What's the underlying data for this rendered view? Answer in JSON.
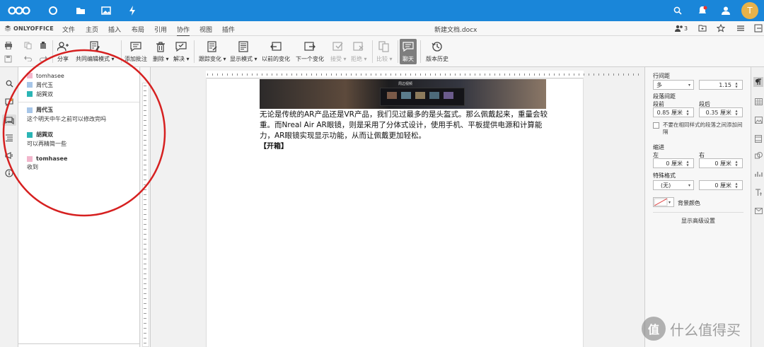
{
  "nc_bar": {
    "accent": "#1a86d9",
    "icons": [
      "nextcloud-logo",
      "dashboard-icon",
      "files-icon",
      "photos-icon",
      "activity-icon",
      "search-icon",
      "notifications-icon",
      "contacts-icon"
    ],
    "avatar_letter": "T",
    "avatar_color": "#e7b24a"
  },
  "menu": {
    "brand": "ONLYOFFICE",
    "tabs": [
      "文件",
      "主页",
      "插入",
      "布局",
      "引用",
      "协作",
      "视图",
      "插件"
    ],
    "active_tab": "协作",
    "doc_title": "新建文档.docx",
    "users_count": "3"
  },
  "toolbar": {
    "share": "分享",
    "coedit_mode": "共同编辑模式",
    "add_comment": "添加批注",
    "delete": "删除",
    "resolve": "解决",
    "track_changes": "跟踪变化",
    "display_mode": "显示模式",
    "prev_change": "以前的变化",
    "next_change": "下一个变化",
    "accept": "接受",
    "reject": "拒绝",
    "compare": "比较",
    "chat": "聊天",
    "version_history": "版本历史"
  },
  "chat": {
    "users": [
      {
        "name": "tomhasee",
        "color": "#f2b6cc"
      },
      {
        "name": "周代玉",
        "color": "#a7c6e8"
      },
      {
        "name": "胡巽双",
        "color": "#2bb5b5"
      }
    ],
    "messages": [
      {
        "author": "周代玉",
        "color": "#a7c6e8",
        "text": "这个明天中午之前可以修改完吗"
      },
      {
        "author": "胡巽双",
        "color": "#2bb5b5",
        "text": "可以再精简一些"
      },
      {
        "author": "tomhasee",
        "color": "#f2b6cc",
        "text": "收到"
      }
    ]
  },
  "document": {
    "image_caption": "周边视频",
    "paragraph_lines": [
      "无论是传统的AR产品还是VR产品，我们见过最多的是头盔式。那么佩戴起来，重量会较",
      "重。而Nreal Air AR眼镜，则是采用了分体式设计，使用手机、平板提供电源和计算能",
      "力，AR眼镜实现显示功能，从而让佩戴更加轻松。"
    ],
    "heading": "【开箱】"
  },
  "paragraph_settings": {
    "line_spacing_label": "行间距",
    "line_spacing_mode": "多",
    "line_spacing_value": "1.15",
    "paragraph_spacing_label": "段落间距",
    "before_label": "段前",
    "after_label": "段后",
    "before_value": "0.85 厘米",
    "after_value": "0.35 厘米",
    "no_space_same_style": "不要在相同样式的段落之间添加间隔",
    "indent_label": "缩进",
    "left_label": "左",
    "right_label": "右",
    "left_value": "0 厘米",
    "right_value": "0 厘米",
    "special_label": "特殊格式",
    "special_value": "(无)",
    "special_amount": "0 厘米",
    "bg_color_label": "背景颜色",
    "advanced_link": "显示高级设置"
  },
  "watermark": {
    "logo": "值",
    "text": "什么值得买"
  }
}
